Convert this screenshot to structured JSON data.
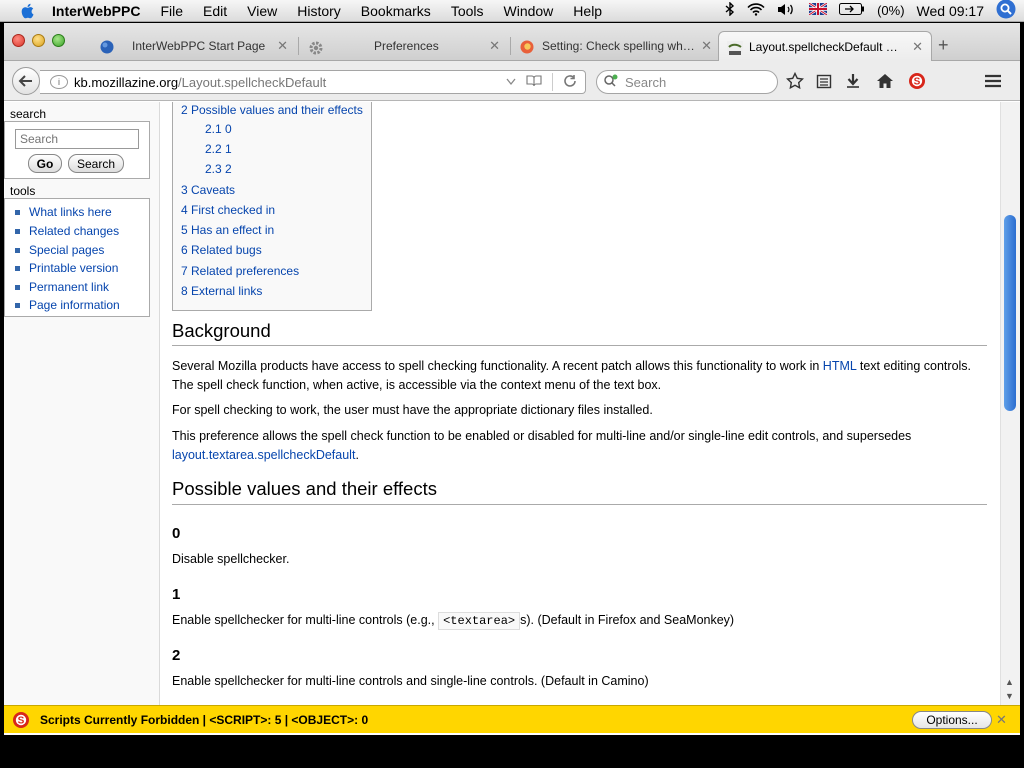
{
  "menubar": {
    "app_name": "InterWebPPC",
    "items": [
      "File",
      "Edit",
      "View",
      "History",
      "Bookmarks",
      "Tools",
      "Window",
      "Help"
    ],
    "battery": "(0%)",
    "clock": "Wed 09:17"
  },
  "tabs": [
    {
      "title": "InterWebPPC Start Page",
      "icon": "globe-icon"
    },
    {
      "title": "Preferences",
      "icon": "gear-icon"
    },
    {
      "title": "Setting: Check spelling wh…",
      "icon": "firefox-icon"
    },
    {
      "title": "Layout.spellcheckDefault …",
      "icon": "mozillazine-icon"
    }
  ],
  "url": {
    "host": "kb.mozillazine.org",
    "path": "/Layout.spellcheckDefault"
  },
  "search": {
    "placeholder": "Search"
  },
  "sidebar": {
    "search_heading": "search",
    "search_placeholder": "Search",
    "go_label": "Go",
    "search_label": "Search",
    "tools_heading": "tools",
    "tools": [
      "What links here",
      "Related changes",
      "Special pages",
      "Printable version",
      "Permanent link",
      "Page information"
    ]
  },
  "toc": [
    "2 Possible values and their effects",
    "2.1 0",
    "2.2 1",
    "2.3 2",
    "3 Caveats",
    "4 First checked in",
    "5 Has an effect in",
    "6 Related bugs",
    "7 Related preferences",
    "8 External links"
  ],
  "article": {
    "background_heading": "Background",
    "p1_a": "Several Mozilla products have access to spell checking functionality. A recent patch allows this functionality to work in ",
    "p1_link": "HTML",
    "p1_b": " text editing controls. The spell check function, when active, is accessible via the context menu of the text box.",
    "p2": "For spell checking to work, the user must have the appropriate dictionary files installed.",
    "p3_a": "This preference allows the spell check function to be enabled or disabled for multi-line and/or single-line edit controls, and supersedes ",
    "p3_link": "layout.textarea.spellcheckDefault",
    "p3_b": ".",
    "values_heading": "Possible values and their effects",
    "v0_heading": "0",
    "v0_text": "Disable spellchecker.",
    "v1_heading": "1",
    "v1_text_a": "Enable spellchecker for multi-line controls (e.g., ",
    "v1_code": "<textarea>",
    "v1_text_b": "s). (Default in Firefox and SeaMonkey)",
    "v2_heading": "2",
    "v2_text": "Enable spellchecker for multi-line controls and single-line controls. (Default in Camino)"
  },
  "notification": {
    "text": "Scripts Currently Forbidden | <SCRIPT>: 5 | <OBJECT>: 0",
    "options_label": "Options...",
    "close": "✕"
  }
}
